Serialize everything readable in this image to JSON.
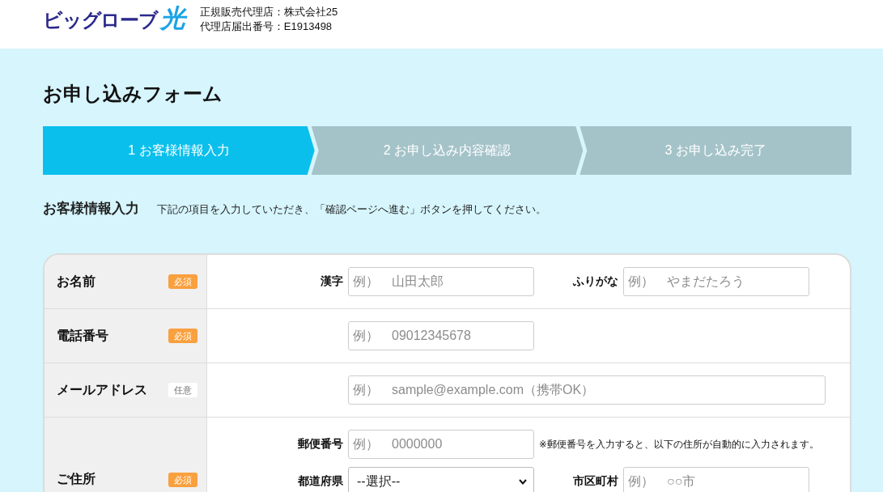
{
  "header": {
    "logo": {
      "text": "ビッグローブ",
      "accent": "光"
    },
    "dealer_lines": [
      "正規販売代理店：株式会社25",
      "代理店届出番号：E1913498"
    ]
  },
  "page_title": "お申し込みフォーム",
  "steps": [
    {
      "label": "1 お客様情報入力",
      "selected": true
    },
    {
      "label": "2 お申し込み内容確認",
      "selected": false
    },
    {
      "label": "3 お申し込み完了",
      "selected": false
    }
  ],
  "section": {
    "title": "お客様情報入力",
    "description": "下記の項目を入力していただき、「確認ページへ進む」ボタンを押してください。"
  },
  "form": {
    "rows": [
      {
        "label": "お名前",
        "badge": {
          "kind": "required",
          "text": "必須"
        },
        "lines": [
          [
            {
              "kind": "input",
              "label": "漢字",
              "placeholder": "例）　山田太郎"
            },
            {
              "kind": "input",
              "label": "ふりがな",
              "placeholder": "例）　やまだたろう"
            }
          ]
        ]
      },
      {
        "label": "電話番号",
        "badge": {
          "kind": "required",
          "text": "必須"
        },
        "lines": [
          [
            {
              "kind": "input",
              "placeholder": "例）　09012345678"
            }
          ]
        ]
      },
      {
        "label": "メールアドレス",
        "badge": {
          "kind": "optional",
          "text": "任意"
        },
        "lines": [
          [
            {
              "kind": "wide_input",
              "placeholder": "例）　sample@example.com（携帯OK）"
            }
          ]
        ]
      },
      {
        "label": "ご住所",
        "badge": {
          "kind": "required",
          "text": "必須"
        },
        "lines": [
          [
            {
              "kind": "input",
              "label": "郵便番号",
              "placeholder": "例）　0000000"
            },
            {
              "kind": "note",
              "text": "※郵便番号を入力すると、以下の住所が自動的に入力されます。"
            }
          ],
          [
            {
              "kind": "select",
              "label": "都道府県",
              "value": "--選択--"
            },
            {
              "kind": "input",
              "label": "市区町村",
              "placeholder": "例）　○○市"
            }
          ]
        ]
      }
    ]
  }
}
